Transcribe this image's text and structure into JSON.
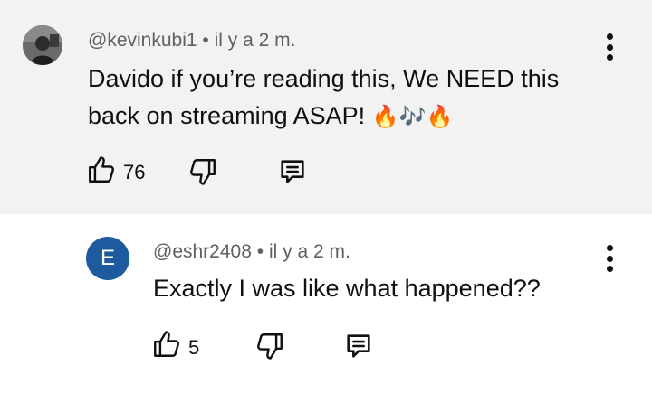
{
  "comment": {
    "author": "@kevinkubi1",
    "separator": "•",
    "time": "il y a 2 m.",
    "text_line1": "Davido if you’re reading this, We NEED this",
    "text_line2": "back on streaming ASAP! ",
    "emoji": "🔥🎶🔥",
    "likes": "76",
    "background": "#f2f2f2"
  },
  "reply": {
    "avatar_letter": "E",
    "avatar_color": "#1e5a9e",
    "author": "@eshr2408",
    "separator": "•",
    "time": "il y a 2 m.",
    "text": "Exactly I was like what happened??",
    "likes": "5"
  },
  "icons": {
    "like": "thumbs-up-icon",
    "dislike": "thumbs-down-icon",
    "reply": "reply-comment-icon",
    "more": "more-vertical-icon"
  }
}
